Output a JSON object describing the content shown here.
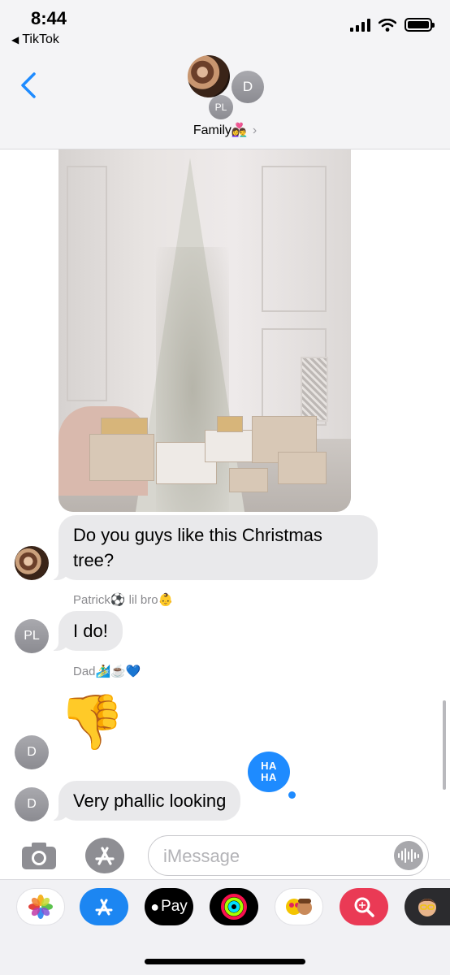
{
  "status_bar": {
    "time": "8:44",
    "back_app": "TikTok",
    "back_arrow": "◀"
  },
  "header": {
    "group_name": "Family👩‍❤️‍👨",
    "chevron": "›",
    "member_initials": [
      "D",
      "PL"
    ]
  },
  "messages": [
    {
      "type": "photo",
      "description_icon": "christmas-tree-photo"
    },
    {
      "type": "text",
      "sender_avatar": "photo",
      "text": "Do you guys like this Christmas tree?"
    },
    {
      "type": "text",
      "sender_label": "Patrick⚽️ lil bro👶",
      "sender_avatar": "PL",
      "text": "I do!"
    },
    {
      "type": "emoji",
      "sender_label": "Dad🏄‍♂️☕️💙",
      "sender_avatar": "D",
      "text": "👎"
    },
    {
      "type": "text",
      "sender_avatar": "D",
      "text": "Very phallic looking",
      "reaction": "HA HA"
    }
  ],
  "input": {
    "placeholder": "iMessage",
    "value": ""
  },
  "drawer": {
    "apps": [
      "photos-icon",
      "app-store-icon",
      "apple-pay-icon",
      "activity-icon",
      "memoji-stickers-icon",
      "search-images-icon",
      "memoji-icon"
    ],
    "apple_pay_label": "Pay"
  },
  "colors": {
    "accent": "#1e8bff",
    "bubble_gray": "#e9e9eb",
    "header_bg": "#f4f4f6"
  }
}
